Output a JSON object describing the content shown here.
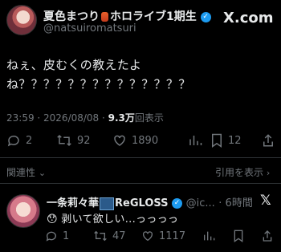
{
  "header": {
    "brand": "X.com"
  },
  "author": {
    "name": "夏色まつり",
    "name_suffix": "ホロライブ1期生",
    "handle": "@natsuiromatsuri"
  },
  "post": {
    "line1": "ねぇ、皮むくの教えたよ",
    "line2": "ね？？？？？？？？？？？？？？",
    "time": "23:59 · 2026/08/08 · ",
    "views_count": "9.3万",
    "views_label": "回表示",
    "stats": {
      "replies": "2",
      "reposts": "92",
      "likes": "1890",
      "bookmarks": "12"
    }
  },
  "sections": {
    "related": "関連性",
    "quotes": "引用を表示"
  },
  "reply": {
    "name": "一条莉々華",
    "group": "ReGLOSS",
    "handle": "@ic...",
    "time": "· 6時間",
    "text": "剥いて欲しい...っっっっ",
    "emoji": "😯",
    "stats": {
      "replies": "1",
      "reposts": "47",
      "likes": "1117"
    }
  }
}
